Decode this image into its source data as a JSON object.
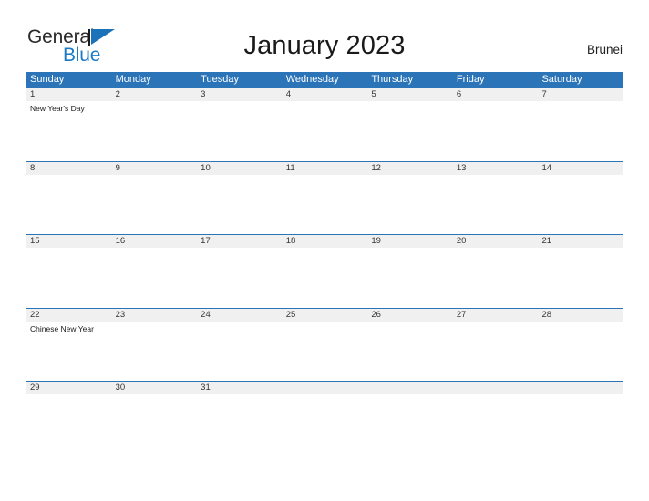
{
  "brand": {
    "word1": "General",
    "word2": "Blue",
    "flag_icon": "blue-triangle-flag-icon",
    "word1_color": "#2b2b2b",
    "word2_color": "#1b7ac4"
  },
  "header": {
    "title": "January 2023",
    "region": "Brunei"
  },
  "theme": {
    "header_blue": "#2b74b8",
    "date_band_gray": "#f0f0f0",
    "row_divider": "#2b74b8",
    "page_background": "#ffffff",
    "text_dark": "#333333"
  },
  "calendar": {
    "month": "January",
    "year": "2023",
    "weekdays": [
      "Sunday",
      "Monday",
      "Tuesday",
      "Wednesday",
      "Thursday",
      "Friday",
      "Saturday"
    ],
    "weeks": [
      {
        "dates": [
          "1",
          "2",
          "3",
          "4",
          "5",
          "6",
          "7"
        ],
        "events": [
          [
            "New Year's Day"
          ],
          [],
          [],
          [],
          [],
          [],
          []
        ]
      },
      {
        "dates": [
          "8",
          "9",
          "10",
          "11",
          "12",
          "13",
          "14"
        ],
        "events": [
          [],
          [],
          [],
          [],
          [],
          [],
          []
        ]
      },
      {
        "dates": [
          "15",
          "16",
          "17",
          "18",
          "19",
          "20",
          "21"
        ],
        "events": [
          [],
          [],
          [],
          [],
          [],
          [],
          []
        ]
      },
      {
        "dates": [
          "22",
          "23",
          "24",
          "25",
          "26",
          "27",
          "28"
        ],
        "events": [
          [
            "Chinese New Year"
          ],
          [],
          [],
          [],
          [],
          [],
          []
        ]
      },
      {
        "dates": [
          "29",
          "30",
          "31",
          "",
          "",
          "",
          ""
        ],
        "events": [
          [],
          [],
          [],
          [],
          [],
          [],
          []
        ]
      }
    ]
  }
}
